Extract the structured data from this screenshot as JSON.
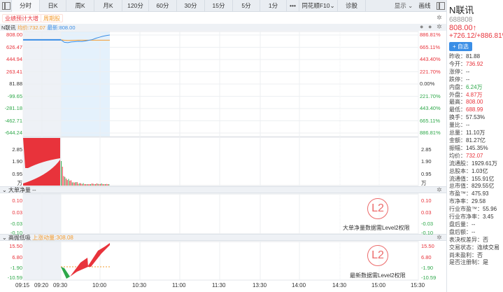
{
  "toolbar": {
    "tabs": [
      "分时",
      "日K",
      "周K",
      "月K",
      "120分",
      "60分",
      "30分",
      "15分",
      "5分",
      "1分",
      "•••",
      "同花顺F10⌄",
      "诊股"
    ],
    "display": "显示 ⌄",
    "draw": "画线"
  },
  "tags": [
    "业绩预计大增",
    "周期股"
  ],
  "legend": {
    "name": "N联讯",
    "avg": "均价:732.07",
    "latest": "最新:808.00"
  },
  "price_axis_left": [
    "808.00",
    "626.47",
    "444.94",
    "263.41",
    "81.88",
    "-99.65",
    "-281.18",
    "-462.71",
    "-644.24"
  ],
  "price_axis_right": [
    "886.81%",
    "665.11%",
    "443.40%",
    "221.70%",
    "0.00%",
    "221.70%",
    "443.40%",
    "665.11%",
    "886.81%"
  ],
  "volume_axis": [
    "2.85",
    "1.90",
    "0.95",
    "万"
  ],
  "panel2": {
    "title": "大单净量",
    "value": "--",
    "axis": [
      "0.10",
      "0.03",
      "-0.03",
      "-0.10"
    ],
    "notice": "大单净量数据需Level2权限",
    "badge": "L2"
  },
  "panel3": {
    "title": "高抛低吸",
    "value": "上涨动量:308.08",
    "axis": [
      "15.50",
      "6.80",
      "-1.90",
      "-10.59"
    ],
    "notice": "最新数据需Level2权限",
    "badge": "L2"
  },
  "time_axis": [
    "09:15",
    "09:20",
    "09:30",
    "10:00",
    "10:30",
    "11:00",
    "11:30",
    "13:30",
    "14:00",
    "14:30",
    "15:00",
    "15:30"
  ],
  "colors": {
    "up": "#e8333b",
    "down": "#2ea84a",
    "avg": "#f39b2f",
    "price": "#3a8ee6"
  },
  "chart_data": {
    "type": "line",
    "prev_close": 81.88,
    "price": [
      736.92,
      700,
      695,
      705,
      710,
      715,
      712,
      720,
      730,
      740,
      760,
      775,
      790,
      800,
      808
    ],
    "avg": [
      736.92,
      730,
      728,
      729,
      730,
      731,
      731,
      731,
      731,
      732,
      732,
      732,
      732,
      732,
      732.07
    ]
  },
  "sidebar": {
    "name": "N联讯",
    "code": "688808",
    "price": "808.00↑",
    "change": "+726.12/+886.81%",
    "add": "+ 自选",
    "rows": [
      {
        "k": "昨收：",
        "v": "81.88",
        "c": ""
      },
      {
        "k": "今开：",
        "v": "736.92",
        "c": "red"
      },
      {
        "k": "涨停：",
        "v": "--",
        "c": ""
      },
      {
        "k": "跌停：",
        "v": "--",
        "c": ""
      },
      {
        "k": "内盘：",
        "v": "6.24万",
        "c": "green"
      },
      {
        "k": "外盘：",
        "v": "4.87万",
        "c": "red"
      },
      {
        "k": "最高：",
        "v": "808.00",
        "c": "red"
      },
      {
        "k": "最低：",
        "v": "688.99",
        "c": "red"
      },
      {
        "k": "换手：",
        "v": "57.53%",
        "c": ""
      },
      {
        "k": "量比：",
        "v": "--",
        "c": ""
      },
      {
        "k": "总量：",
        "v": "11.10万",
        "c": ""
      },
      {
        "k": "金额：",
        "v": "81.27亿",
        "c": ""
      },
      {
        "k": "振幅：",
        "v": "145.35%",
        "c": ""
      },
      {
        "k": "均价：",
        "v": "732.07",
        "c": "red"
      },
      {
        "k": "流通股：",
        "v": "1929.61万",
        "c": ""
      },
      {
        "k": "总股本：",
        "v": "1.03亿",
        "c": ""
      },
      {
        "k": "流通值：",
        "v": "155.91亿",
        "c": ""
      },
      {
        "k": "总市值：",
        "v": "829.55亿",
        "c": ""
      },
      {
        "k": "市盈™：",
        "v": "475.93",
        "c": ""
      },
      {
        "k": "市净率：",
        "v": "29.58",
        "c": ""
      },
      {
        "k": "行业市盈™：",
        "v": "55.96",
        "c": ""
      },
      {
        "k": "行业市净率：",
        "v": "3.45",
        "c": ""
      },
      {
        "k": "盘后量：",
        "v": "--",
        "c": ""
      },
      {
        "k": "盘后额：",
        "v": "--",
        "c": ""
      },
      {
        "k": "表决权差异：",
        "v": "否",
        "c": ""
      },
      {
        "k": "交易状态：",
        "v": "连续交易",
        "c": ""
      },
      {
        "k": "尚未盈利：",
        "v": "否",
        "c": ""
      },
      {
        "k": "是否注册制：",
        "v": "是",
        "c": ""
      }
    ]
  }
}
